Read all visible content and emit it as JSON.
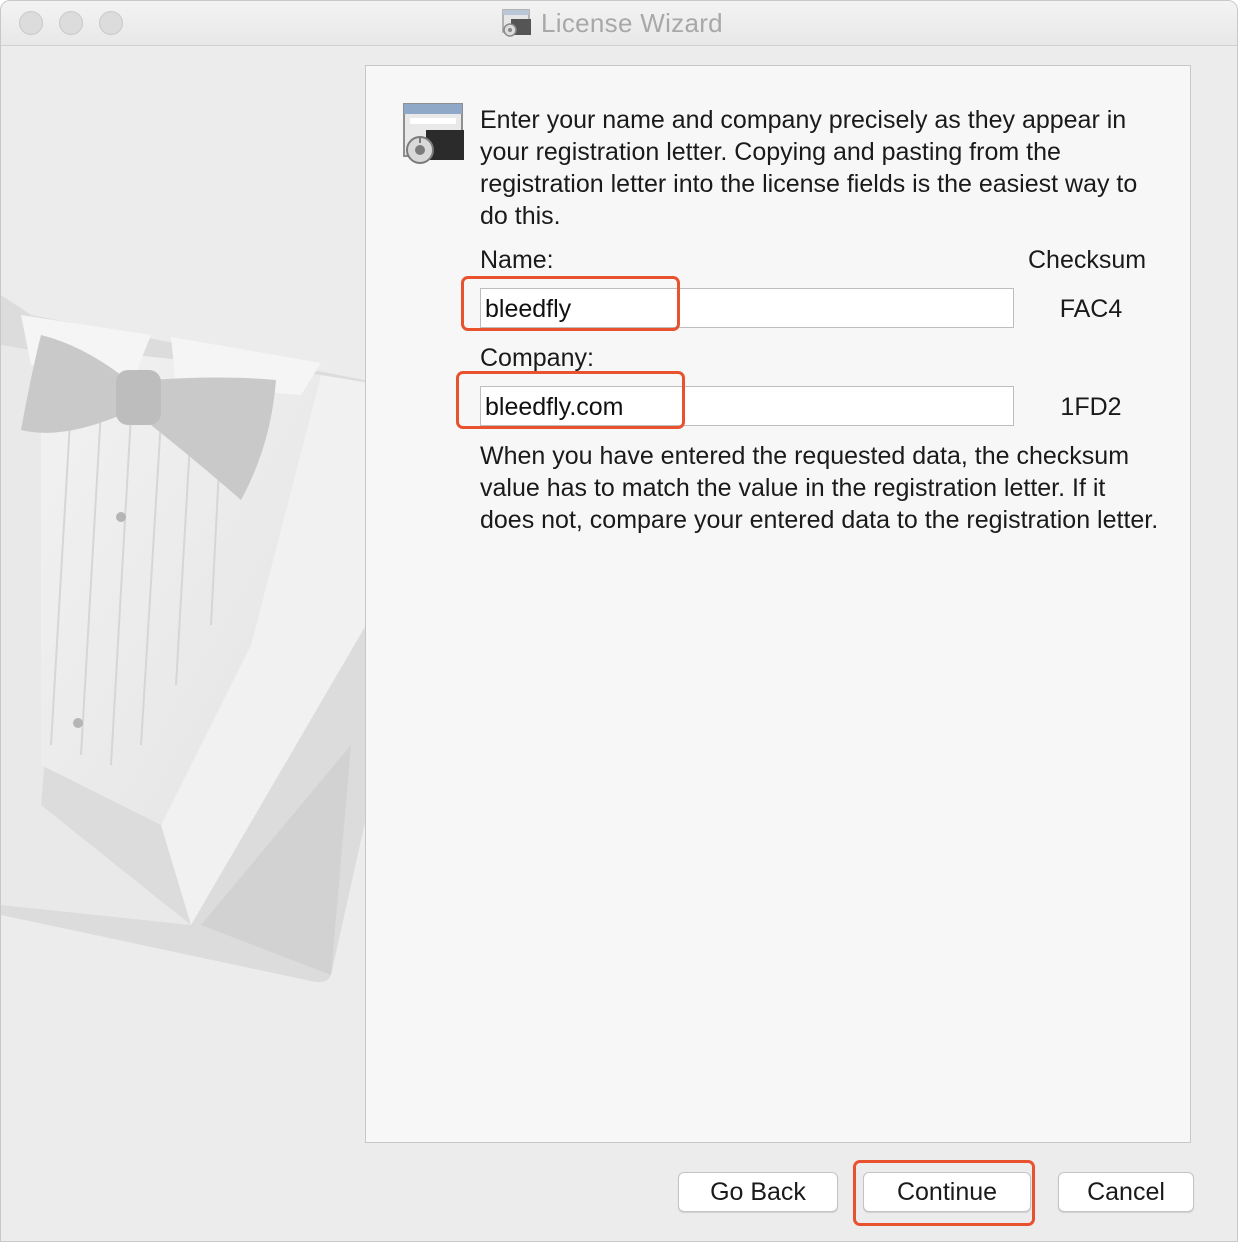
{
  "window": {
    "title": "License Wizard",
    "title_icon": "license-wizard-icon"
  },
  "intro_text": "Enter your name and company precisely as they appear in your registration letter.  Copying and pasting from the registration letter into the license fields is the easiest way to do this.",
  "form": {
    "name_label": "Name:",
    "checksum_header": "Checksum",
    "name_value": "bleedfly",
    "name_checksum": "FAC4",
    "company_label": "Company:",
    "company_value": "bleedfly.com",
    "company_checksum": "1FD2"
  },
  "help_text": "When you have entered the requested data, the checksum value has to match the value in the registration letter.  If it does not, compare your entered data to the registration letter.",
  "buttons": {
    "go_back": "Go Back",
    "continue": "Continue",
    "cancel": "Cancel"
  },
  "colors": {
    "highlight": "#e8522f",
    "panel_background": "#f7f7f7",
    "window_background": "#ececec"
  },
  "decoration": "tuxedo-bowtie-artwork"
}
